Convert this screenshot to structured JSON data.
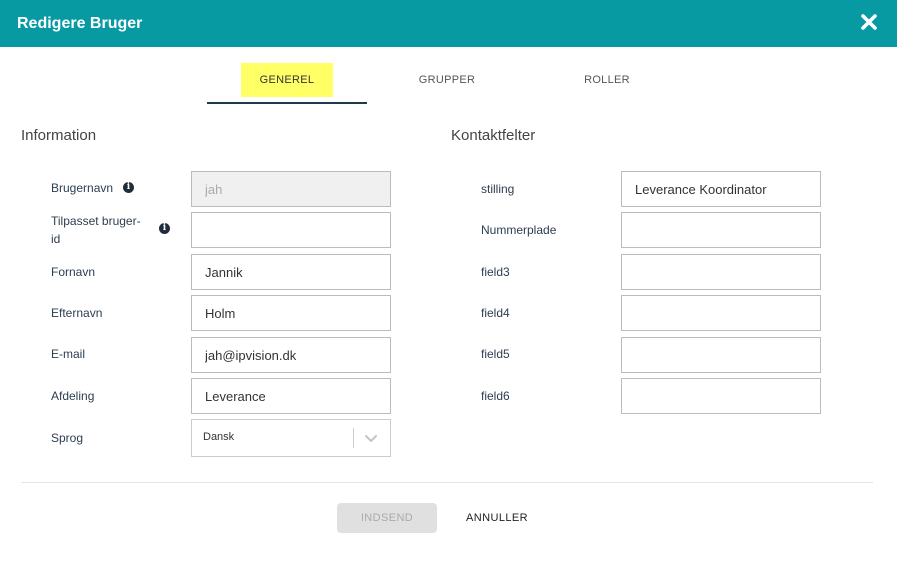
{
  "header": {
    "title": "Redigere Bruger",
    "close_icon": "close-icon"
  },
  "tabs": [
    {
      "label": "GENEREL",
      "active": true
    },
    {
      "label": "GRUPPER",
      "active": false
    },
    {
      "label": "ROLLER",
      "active": false
    }
  ],
  "colors": {
    "header_bg": "#079aa3",
    "active_tab_highlight": "#ffff66",
    "tab_underline": "#1f3a4d"
  },
  "information": {
    "title": "Information",
    "brugernavn": {
      "label": "Brugernavn",
      "value": "jah",
      "disabled": true,
      "icon": "info-icon"
    },
    "tilpasset": {
      "label_line1": "Tilpasset bruger-",
      "label_line2": "id",
      "value": "",
      "icon": "info-icon"
    },
    "fornavn": {
      "label": "Fornavn",
      "value": "Jannik"
    },
    "efternavn": {
      "label": "Efternavn",
      "value": "Holm"
    },
    "email": {
      "label": "E-mail",
      "value": "jah@ipvision.dk"
    },
    "afdeling": {
      "label": "Afdeling",
      "value": "Leverance"
    },
    "sprog": {
      "label": "Sprog",
      "value": "Dansk",
      "icon": "chevron-down-icon"
    }
  },
  "kontakt": {
    "title": "Kontaktfelter",
    "stilling": {
      "label": "stilling",
      "value": "Leverance Koordinator"
    },
    "nummerplade": {
      "label": "Nummerplade",
      "value": ""
    },
    "field3": {
      "label": "field3",
      "value": ""
    },
    "field4": {
      "label": "field4",
      "value": ""
    },
    "field5": {
      "label": "field5",
      "value": ""
    },
    "field6": {
      "label": "field6",
      "value": ""
    }
  },
  "footer": {
    "submit_label": "INDSEND",
    "cancel_label": "ANNULLER"
  }
}
